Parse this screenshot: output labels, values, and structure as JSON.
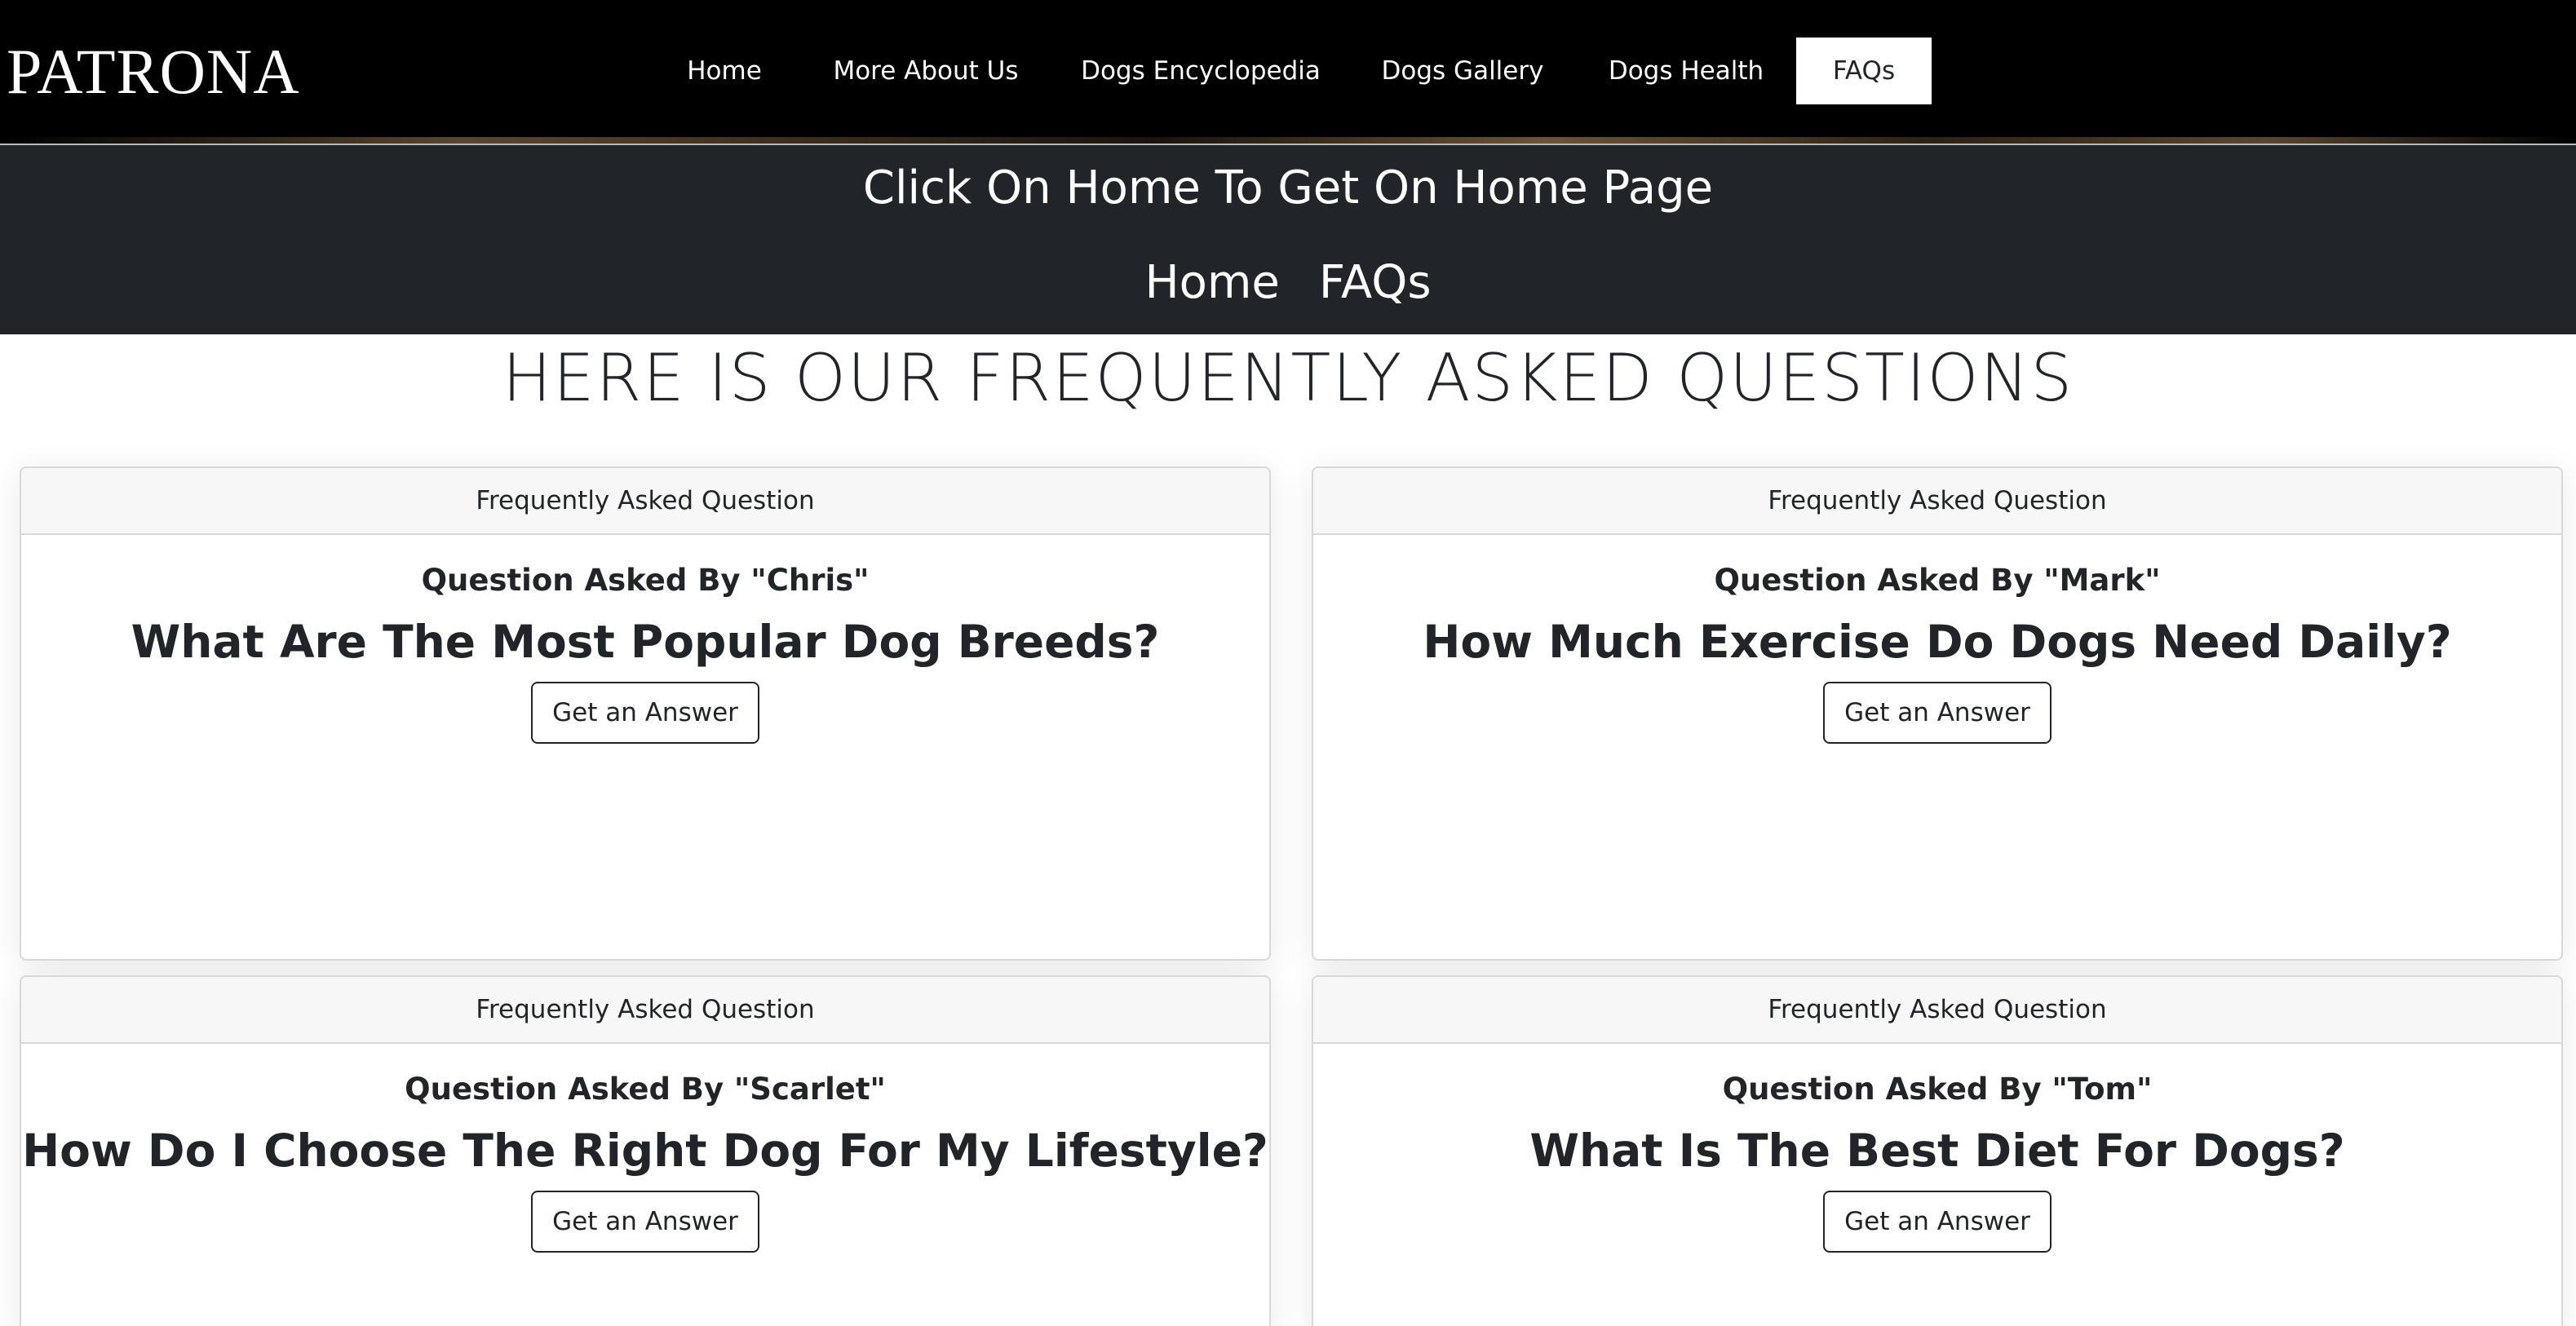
{
  "brand": {
    "name": "PATRONA"
  },
  "nav": {
    "items": [
      {
        "label": "Home"
      },
      {
        "label": "More About Us"
      },
      {
        "label": "Dogs Encyclopedia"
      },
      {
        "label": "Dogs Gallery"
      },
      {
        "label": "Dogs Health"
      },
      {
        "label": "FAQs",
        "active": true
      }
    ]
  },
  "breadcrumb": {
    "title": "Click On Home To Get On Home Page",
    "links": [
      "Home",
      "FAQs"
    ]
  },
  "section": {
    "title": "HERE IS OUR FREQUENTLY ASKED QUESTIONS"
  },
  "cards": [
    {
      "header": "Frequently Asked Question",
      "asker": "Question Asked By \"Chris\"",
      "question": "What Are The Most Popular Dog Breeds?",
      "button": "Get an Answer"
    },
    {
      "header": "Frequently Asked Question",
      "asker": "Question Asked By \"Mark\"",
      "question": "How Much Exercise Do Dogs Need Daily?",
      "button": "Get an Answer"
    },
    {
      "header": "Frequently Asked Question",
      "asker": "Question Asked By \"Scarlet\"",
      "question": "How Do I Choose The Right Dog For My Lifestyle?",
      "button": "Get an Answer"
    },
    {
      "header": "Frequently Asked Question",
      "asker": "Question Asked By \"Tom\"",
      "question": "What Is The Best Diet For Dogs?",
      "button": "Get an Answer"
    }
  ],
  "colors": {
    "navbar_bg": "#000000",
    "breadcrumb_bg": "#212529",
    "text": "#212529",
    "card_header_bg": "#f7f7f7"
  }
}
